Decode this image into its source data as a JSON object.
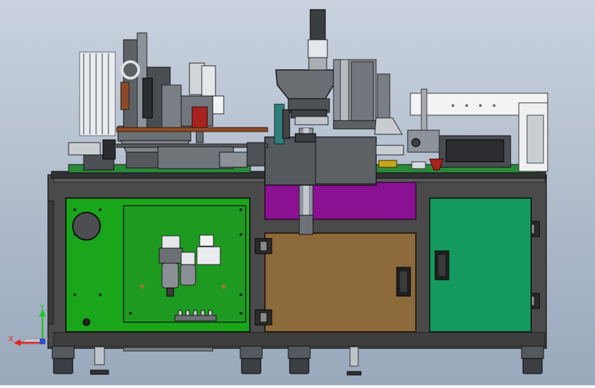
{
  "viewport": {
    "background_top": "#c9d2de",
    "background_bottom": "#9aa8bc"
  },
  "triad": {
    "x_label": "X",
    "y_label": "Y",
    "x_color": "#e0241b",
    "y_color": "#25c22a"
  },
  "colors": {
    "frame": "#4a4a4a",
    "frame_edge": "#1c1c1c",
    "panel_green": "#1aa61a",
    "inner_green": "#1f9a21",
    "panel_teal": "#149a5e",
    "panel_brown": "#8d6a3b",
    "panel_purple": "#8a1191",
    "plate_green": "#2a8a3a",
    "metal_light": "#d9dde3",
    "metal_mid": "#9ea4ab",
    "metal_dark": "#5b5f65",
    "accent_brown": "#8b4a25",
    "accent_red": "#a8231f",
    "accent_yellow": "#c8a51a",
    "accent_teal": "#2f7f7a"
  }
}
